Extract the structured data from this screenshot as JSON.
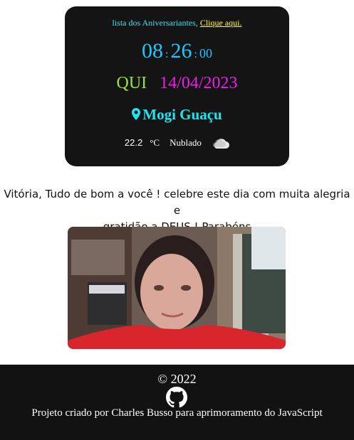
{
  "clock": {
    "link_prefix": "lista dos Aniversariantes,",
    "link_text": "Clique aqui.",
    "hours": "08",
    "sep1": ":",
    "minutes": "26",
    "sep2": ":",
    "seconds": "00",
    "day": "QUI",
    "date": "14/04/2023",
    "city": "Mogi Guaçu",
    "temp": "22.2",
    "unit": "°C",
    "condition": "Nublado"
  },
  "message": {
    "line1": "Vitória, Tudo de bom a você ! celebre este dia com muita alegria e",
    "line2": "gratidão a DEUS ! Parabéns"
  },
  "footer": {
    "copyright": "© 2022",
    "credit": "Projeto criado por Charles Busso para aprimoramento do JavaScript"
  },
  "icons": [
    "map-marker-icon",
    "cloud-icon",
    "github-icon"
  ]
}
